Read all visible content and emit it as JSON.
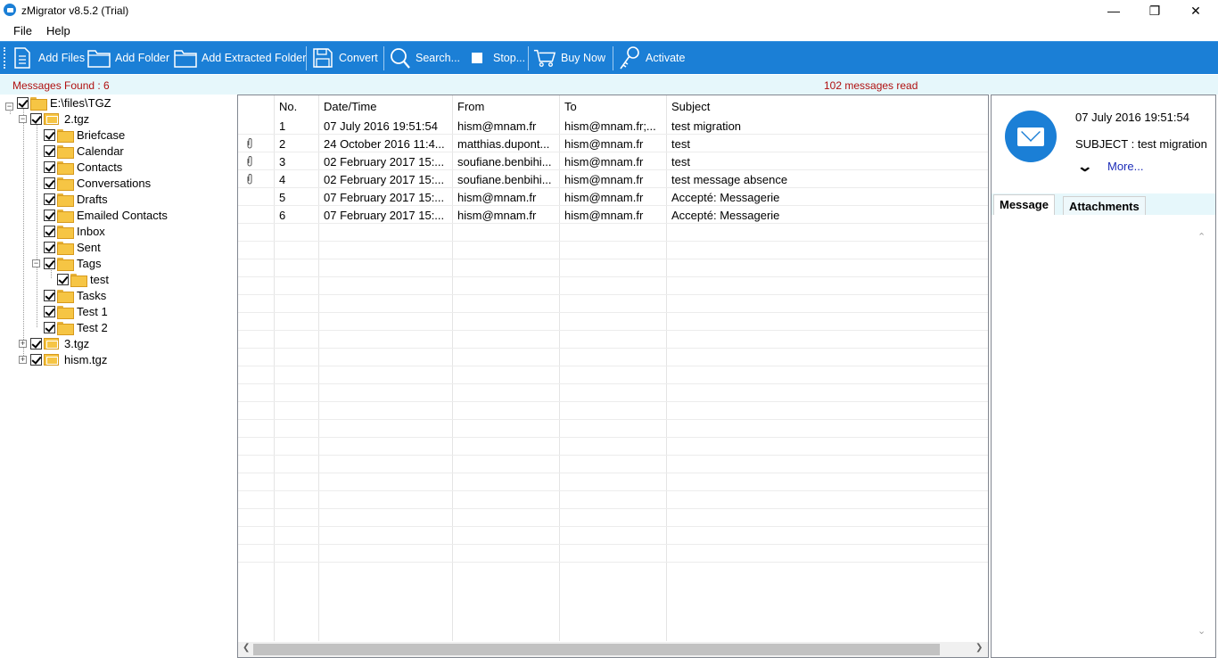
{
  "window": {
    "title": "zMigrator v8.5.2 (Trial)",
    "minimize": "—",
    "maximize": "❐",
    "close": "✕"
  },
  "menu": {
    "file": "File",
    "help": "Help"
  },
  "toolbar": {
    "add_files": "Add Files",
    "add_folder": "Add Folder",
    "add_extracted_folder": "Add Extracted Folder",
    "convert": "Convert",
    "search": "Search...",
    "stop": "Stop...",
    "buy_now": "Buy Now",
    "activate": "Activate"
  },
  "status": {
    "messages_found": "Messages Found : 6",
    "messages_read": "102 messages read"
  },
  "tree": {
    "root": "E:\\files\\TGZ",
    "archive1": "2.tgz",
    "folders": [
      "Briefcase",
      "Calendar",
      "Contacts",
      "Conversations",
      "Drafts",
      "Emailed Contacts",
      "Inbox",
      "Sent",
      "Tags",
      "test",
      "Tasks",
      "Test 1",
      "Test 2"
    ],
    "archive2": "3.tgz",
    "archive3": "hism.tgz"
  },
  "grid": {
    "columns": [
      "No.",
      "Date/Time",
      "From",
      "To",
      "Subject"
    ],
    "rows": [
      {
        "no": "1",
        "date": "07 July 2016 19:51:54",
        "from": "hism@mnam.fr",
        "to": "hism@mnam.fr;...",
        "subject": "test migration",
        "attachment": false
      },
      {
        "no": "2",
        "date": "24 October 2016 11:4...",
        "from": "matthias.dupont...",
        "to": "hism@mnam.fr",
        "subject": "test",
        "attachment": true
      },
      {
        "no": "3",
        "date": "02 February 2017 15:...",
        "from": "soufiane.benbihi...",
        "to": "hism@mnam.fr",
        "subject": "test",
        "attachment": true
      },
      {
        "no": "4",
        "date": "02 February 2017 15:...",
        "from": "soufiane.benbihi...",
        "to": "hism@mnam.fr",
        "subject": "test message absence",
        "attachment": true
      },
      {
        "no": "5",
        "date": "07 February 2017 15:...",
        "from": "hism@mnam.fr",
        "to": "hism@mnam.fr",
        "subject": "Accepté: Messagerie",
        "attachment": false
      },
      {
        "no": "6",
        "date": "07 February 2017 15:...",
        "from": "hism@mnam.fr",
        "to": "hism@mnam.fr",
        "subject": "Accepté: Messagerie",
        "attachment": false
      }
    ]
  },
  "preview": {
    "date": "07 July 2016 19:51:54",
    "subject": "SUBJECT : test migration",
    "more": "More...",
    "tab_message": "Message",
    "tab_attachments": "Attachments"
  },
  "colors": {
    "accent": "#1b7fd6",
    "status_text": "#b01010",
    "strip_bg": "#e6f7fb"
  }
}
